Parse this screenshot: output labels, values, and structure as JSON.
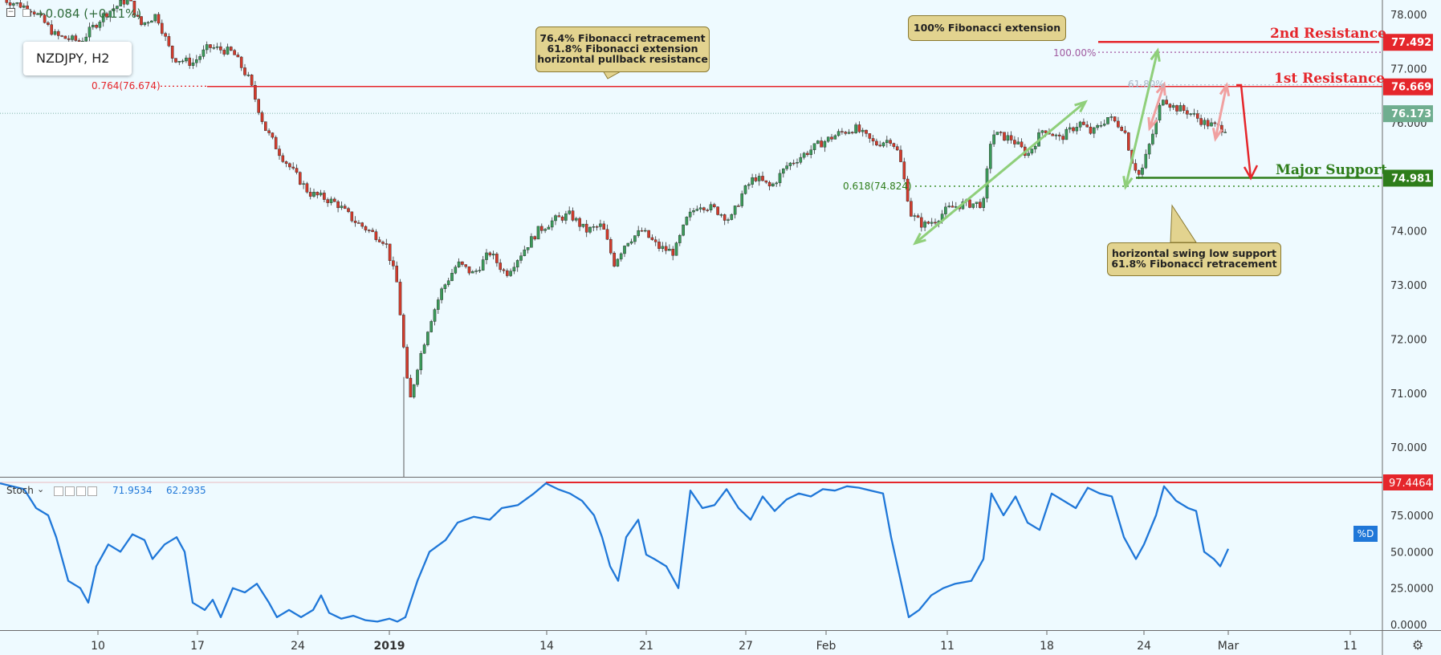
{
  "header": {
    "change_text": "+0.084 (+0.11%)",
    "symbol_box": "NZDJPY, H2"
  },
  "price_axis": {
    "ticks": [
      "78.000",
      "77.000",
      "76.000",
      "74.000",
      "73.000",
      "72.000",
      "71.000",
      "70.000"
    ],
    "tags": [
      {
        "label": "77.492",
        "color": "#e5262b"
      },
      {
        "label": "76.669",
        "color": "#e5262b"
      },
      {
        "label": "76.173",
        "color": "#6fae8f"
      },
      {
        "label": "74.981",
        "color": "#2e7d1a"
      }
    ]
  },
  "time_axis": {
    "ticks": [
      "10",
      "17",
      "24",
      "2019",
      "14",
      "21",
      "27",
      "Feb",
      "11",
      "18",
      "24",
      "Mar",
      "11"
    ]
  },
  "stoch": {
    "label": "Stoch",
    "value_k": "71.9534",
    "value_d": "62.2935",
    "ticks": [
      "75.0000",
      "50.0000",
      "25.0000",
      "0.0000"
    ],
    "tag_high": "97.4464",
    "tag_d": "%D"
  },
  "annotations": {
    "resistance2": "2nd Resistance",
    "resistance1": "1st Resistance",
    "support": "Major Support",
    "fib_left": "0.764(76.674)",
    "fib_support": "0.618(74.824)",
    "fib_100": "100.00%",
    "fib_61": "61.80%",
    "box_left": [
      "76.4% Fibonacci retracement",
      "61.8% Fibonacci extension",
      "horizontal pullback resistance"
    ],
    "box_top": "100% Fibonacci extension",
    "box_bottom": [
      "horizontal swing low support",
      "61.8% Fibonacci retracement"
    ]
  },
  "chart_data": {
    "type": "candlestick",
    "title": "NZDJPY, H2",
    "x_ticks": [
      "10",
      "17",
      "24",
      "2019",
      "14",
      "21",
      "27",
      "Feb",
      "11",
      "18",
      "24",
      "Mar",
      "11"
    ],
    "ylim": [
      69.5,
      78.1
    ],
    "levels": {
      "resistance2": 77.492,
      "resistance1": 76.669,
      "last_price": 76.173,
      "major_support": 74.981,
      "fib_0_764": 76.674,
      "fib_0_618": 74.824
    },
    "price_path": [
      [
        0,
        78.3
      ],
      [
        40,
        78.1
      ],
      [
        70,
        77.6
      ],
      [
        100,
        77.5
      ],
      [
        130,
        78.0
      ],
      [
        160,
        78.3
      ],
      [
        175,
        77.8
      ],
      [
        195,
        78.0
      ],
      [
        215,
        77.2
      ],
      [
        240,
        77.1
      ],
      [
        260,
        77.4
      ],
      [
        290,
        77.3
      ],
      [
        310,
        76.8
      ],
      [
        330,
        75.9
      ],
      [
        350,
        75.4
      ],
      [
        370,
        75.0
      ],
      [
        385,
        74.7
      ],
      [
        405,
        74.6
      ],
      [
        420,
        74.5
      ],
      [
        440,
        74.2
      ],
      [
        460,
        74.0
      ],
      [
        480,
        73.8
      ],
      [
        495,
        73.0
      ],
      [
        505,
        71.5
      ],
      [
        510,
        70.8
      ],
      [
        520,
        71.5
      ],
      [
        535,
        72.3
      ],
      [
        550,
        72.9
      ],
      [
        570,
        73.4
      ],
      [
        590,
        73.2
      ],
      [
        610,
        73.6
      ],
      [
        630,
        73.2
      ],
      [
        650,
        73.6
      ],
      [
        670,
        74.0
      ],
      [
        690,
        74.2
      ],
      [
        710,
        74.3
      ],
      [
        730,
        74.0
      ],
      [
        750,
        74.1
      ],
      [
        765,
        73.4
      ],
      [
        780,
        73.8
      ],
      [
        800,
        74.0
      ],
      [
        820,
        73.7
      ],
      [
        840,
        73.6
      ],
      [
        855,
        74.2
      ],
      [
        870,
        74.5
      ],
      [
        890,
        74.4
      ],
      [
        910,
        74.2
      ],
      [
        925,
        74.7
      ],
      [
        940,
        75.0
      ],
      [
        960,
        74.8
      ],
      [
        980,
        75.2
      ],
      [
        1000,
        75.4
      ],
      [
        1020,
        75.6
      ],
      [
        1045,
        75.8
      ],
      [
        1065,
        75.9
      ],
      [
        1090,
        75.6
      ],
      [
        1110,
        75.7
      ],
      [
        1120,
        75.4
      ],
      [
        1135,
        74.3
      ],
      [
        1150,
        74.1
      ],
      [
        1165,
        74.2
      ],
      [
        1180,
        74.4
      ],
      [
        1200,
        74.5
      ],
      [
        1225,
        74.5
      ],
      [
        1235,
        75.8
      ],
      [
        1260,
        75.7
      ],
      [
        1280,
        75.4
      ],
      [
        1300,
        75.9
      ],
      [
        1320,
        75.7
      ],
      [
        1345,
        76.0
      ],
      [
        1360,
        75.8
      ],
      [
        1380,
        76.1
      ],
      [
        1400,
        75.9
      ],
      [
        1410,
        75.3
      ],
      [
        1420,
        75.0
      ],
      [
        1430,
        75.5
      ],
      [
        1440,
        76.0
      ],
      [
        1448,
        76.5
      ],
      [
        1460,
        76.3
      ],
      [
        1480,
        76.2
      ],
      [
        1500,
        76.0
      ],
      [
        1520,
        75.9
      ],
      [
        1528,
        75.9
      ],
      [
        1538,
        76.2
      ]
    ],
    "stochastic_d": [
      [
        0,
        97
      ],
      [
        30,
        93
      ],
      [
        45,
        80
      ],
      [
        60,
        75
      ],
      [
        70,
        60
      ],
      [
        85,
        30
      ],
      [
        100,
        25
      ],
      [
        110,
        15
      ],
      [
        120,
        40
      ],
      [
        135,
        55
      ],
      [
        150,
        50
      ],
      [
        165,
        62
      ],
      [
        180,
        58
      ],
      [
        190,
        45
      ],
      [
        205,
        55
      ],
      [
        220,
        60
      ],
      [
        230,
        50
      ],
      [
        240,
        15
      ],
      [
        255,
        10
      ],
      [
        265,
        17
      ],
      [
        275,
        5
      ],
      [
        290,
        25
      ],
      [
        305,
        22
      ],
      [
        320,
        28
      ],
      [
        335,
        15
      ],
      [
        345,
        5
      ],
      [
        360,
        10
      ],
      [
        375,
        5
      ],
      [
        390,
        10
      ],
      [
        400,
        20
      ],
      [
        410,
        8
      ],
      [
        425,
        4
      ],
      [
        440,
        6
      ],
      [
        455,
        3
      ],
      [
        470,
        2
      ],
      [
        485,
        4
      ],
      [
        495,
        2
      ],
      [
        505,
        5
      ],
      [
        520,
        30
      ],
      [
        535,
        50
      ],
      [
        555,
        58
      ],
      [
        570,
        70
      ],
      [
        590,
        74
      ],
      [
        610,
        72
      ],
      [
        625,
        80
      ],
      [
        645,
        82
      ],
      [
        665,
        90
      ],
      [
        680,
        97
      ],
      [
        695,
        93
      ],
      [
        710,
        90
      ],
      [
        725,
        85
      ],
      [
        740,
        75
      ],
      [
        750,
        60
      ],
      [
        760,
        40
      ],
      [
        770,
        30
      ],
      [
        780,
        60
      ],
      [
        795,
        72
      ],
      [
        805,
        48
      ],
      [
        815,
        45
      ],
      [
        830,
        40
      ],
      [
        845,
        25
      ],
      [
        860,
        92
      ],
      [
        875,
        80
      ],
      [
        890,
        82
      ],
      [
        905,
        93
      ],
      [
        920,
        80
      ],
      [
        935,
        72
      ],
      [
        950,
        88
      ],
      [
        965,
        78
      ],
      [
        980,
        86
      ],
      [
        995,
        90
      ],
      [
        1010,
        88
      ],
      [
        1025,
        93
      ],
      [
        1040,
        92
      ],
      [
        1055,
        95
      ],
      [
        1070,
        94
      ],
      [
        1085,
        92
      ],
      [
        1100,
        90
      ],
      [
        1110,
        60
      ],
      [
        1122,
        30
      ],
      [
        1132,
        5
      ],
      [
        1145,
        10
      ],
      [
        1160,
        20
      ],
      [
        1175,
        25
      ],
      [
        1190,
        28
      ],
      [
        1210,
        30
      ],
      [
        1225,
        45
      ],
      [
        1235,
        90
      ],
      [
        1250,
        75
      ],
      [
        1265,
        88
      ],
      [
        1280,
        70
      ],
      [
        1295,
        65
      ],
      [
        1310,
        90
      ],
      [
        1325,
        85
      ],
      [
        1340,
        80
      ],
      [
        1355,
        94
      ],
      [
        1370,
        90
      ],
      [
        1385,
        88
      ],
      [
        1400,
        60
      ],
      [
        1415,
        45
      ],
      [
        1425,
        55
      ],
      [
        1440,
        75
      ],
      [
        1450,
        95
      ],
      [
        1465,
        85
      ],
      [
        1480,
        80
      ],
      [
        1490,
        78
      ],
      [
        1500,
        50
      ],
      [
        1512,
        45
      ],
      [
        1520,
        40
      ],
      [
        1530,
        52
      ]
    ]
  }
}
